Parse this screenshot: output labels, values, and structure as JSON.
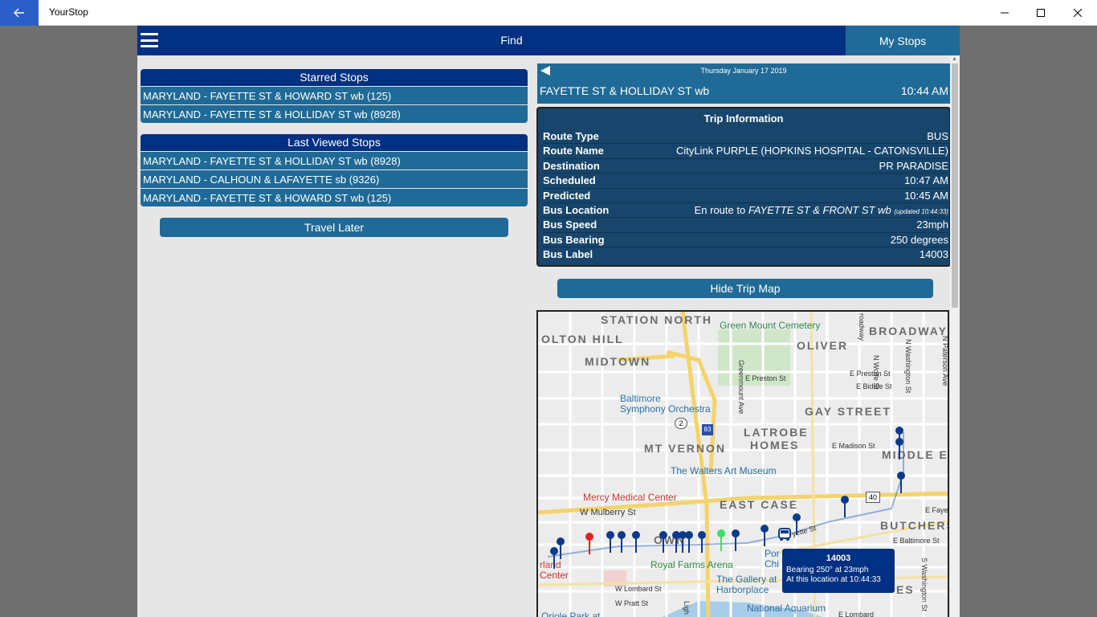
{
  "window": {
    "title": "YourStop"
  },
  "topbar": {
    "find_label": "Find",
    "mystops_label": "My Stops"
  },
  "starred": {
    "header": "Starred Stops",
    "items": [
      "MARYLAND - FAYETTE ST & HOWARD ST wb (125)",
      "MARYLAND - FAYETTE ST & HOLLIDAY ST wb (8928)"
    ]
  },
  "last_viewed": {
    "header": "Last Viewed Stops",
    "items": [
      "MARYLAND - FAYETTE ST & HOLLIDAY ST wb (8928)",
      "MARYLAND - CALHOUN & LAFAYETTE sb (9326)",
      "MARYLAND - FAYETTE ST & HOWARD ST wb (125)"
    ]
  },
  "travel_later_label": "Travel Later",
  "stop_header": {
    "date": "Thursday January 17 2019",
    "stop_name": "FAYETTE ST & HOLLIDAY ST wb",
    "time": "10:44 AM"
  },
  "trip": {
    "title": "Trip Information",
    "route_type_label": "Route Type",
    "route_type": "BUS",
    "route_name_label": "Route Name",
    "route_name": "CityLink PURPLE (HOPKINS HOSPITAL - CATONSVILLE)",
    "destination_label": "Destination",
    "destination": "PR PARADISE",
    "scheduled_label": "Scheduled",
    "scheduled": "10:47 AM",
    "predicted_label": "Predicted",
    "predicted": "10:45 AM",
    "bus_location_label": "Bus Location",
    "bus_location_prefix": "En route to",
    "bus_location_stop": "FAYETTE ST & FRONT ST wb",
    "bus_location_updated": "(updated 10:44:33)",
    "bus_speed_label": "Bus Speed",
    "bus_speed": "23mph",
    "bus_bearing_label": "Bus Bearing",
    "bus_bearing": "250 degrees",
    "bus_label_label": "Bus Label",
    "bus_label": "14003"
  },
  "hide_map_label": "Hide Trip Map",
  "map": {
    "areas": {
      "station_north": "STATION NORTH",
      "bolton_hill": "OLTON HILL",
      "midtown": "MIDTOWN",
      "oliver": "OLIVER",
      "broadway": "BROADWAY",
      "gay_street": "GAY STREET",
      "latrobe": "LATROBE",
      "homes": "HOMES",
      "mt_vernon": "MT VERNON",
      "middle_e": "MIDDLE E",
      "east_case": "EAST CASE",
      "butchers": "BUTCHERS",
      "downtown": "OWN",
      "es": "ES"
    },
    "pois": {
      "cemetery": "Green Mount Cemetery",
      "symphony_1": "Baltimore",
      "symphony_2": "Symphony Orchestra",
      "walters": "The Walters Art Museum",
      "mercy": "Mercy Medical Center",
      "royal_farms": "Royal Farms Arena",
      "gallery_1": "The Gallery at",
      "gallery_2": "Harborplace",
      "aquarium": "National Aquarium",
      "maryland_center_1": "rland",
      "maryland_center_2": "Center",
      "port": "Por",
      "port2": "Chi",
      "oriole": "Oriole Park at"
    },
    "streets": {
      "preston_w": "E Preston St",
      "preston_e": "E Preston St",
      "biddle": "E Biddle St",
      "madison": "E Madison St",
      "mulberry": "W Mulberry St",
      "lombard": "W Lombard St",
      "pratt": "W Pratt St",
      "fayette_e": "E Fayet",
      "baltimore_e": "E Baltimore St",
      "fayette": "yette St",
      "wolfe": "N Wolfe St",
      "washington": "N Washington St",
      "greenmount": "Greenmount Ave",
      "s_washington": "S Washington St",
      "e_lombard": "E Lombard",
      "route_2": "2",
      "route_83": "83",
      "route_40": "40",
      "broadway_st": "roadway",
      "n_paterson": "N Paterson Ave",
      "light": "Ligh"
    },
    "tooltip": {
      "bus_id": "14003",
      "line1": "Bearing 250° at 23mph",
      "line2": "At this location at 10:44:33"
    }
  }
}
